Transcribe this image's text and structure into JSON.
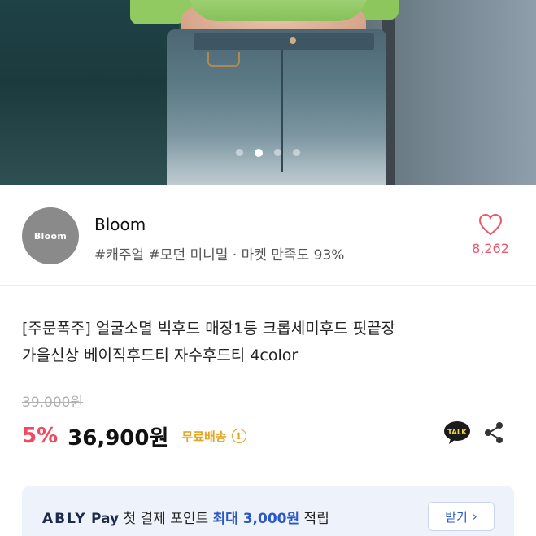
{
  "hero": {
    "image_alt": "Product photo — model wearing a green top and washed denim skirt",
    "carousel": {
      "count": 4,
      "active_index": 1
    }
  },
  "seller": {
    "avatar_text": "Bloom",
    "name": "Bloom",
    "tags": "#캐주얼 #모던 미니멀 · 마켓 만족도 93%",
    "like_count": "8,262",
    "icons": {
      "like": "heart-outline-icon"
    }
  },
  "product": {
    "title_line1": "[주문폭주] 얼굴소멸 빅후드 매장1등 크롭세미후드 핏끝장",
    "title_line2": "가을신상 베이직후드티 자수후드티 4color",
    "original_price": "39,000원",
    "discount": "5%",
    "price": "36,900원",
    "free_shipping": "무료배송",
    "info_symbol": "i",
    "talk_label": "TALK",
    "icons": {
      "info": "info-circle-icon",
      "talk": "kakao-talk-icon",
      "share": "share-icon"
    }
  },
  "banner": {
    "brand": "ABLY",
    "pay": "Pay",
    "text_before": "첫 결제 포인트 ",
    "highlight": "최대 3,000원",
    "text_after": " 적립",
    "button_label": "받기",
    "button_chevron": "›"
  },
  "colors": {
    "accent_pink": "#e8596b",
    "discount_red": "#f2495f",
    "shipping_gold": "#e3a41e",
    "banner_blue": "#2b57c8",
    "banner_bg": "#eef2fa"
  }
}
